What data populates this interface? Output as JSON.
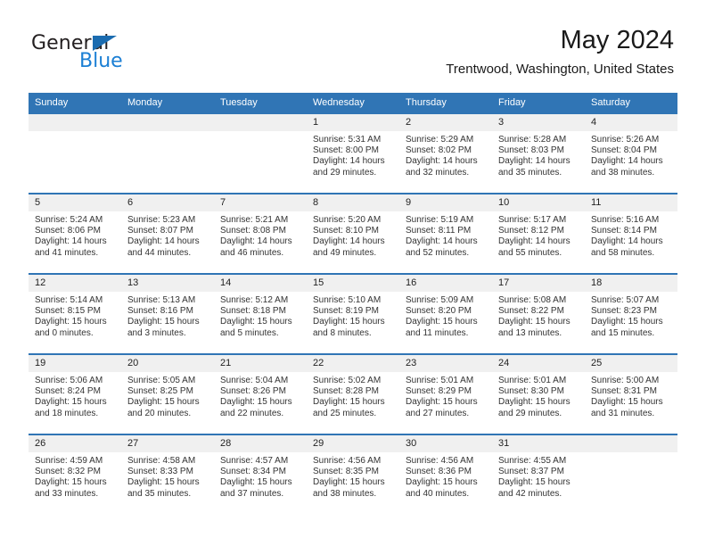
{
  "brand": {
    "name_part1": "General",
    "name_part2": "Blue",
    "accent_color": "#1b7fd4",
    "triangle_color": "#1b6cb0"
  },
  "header": {
    "title": "May 2024",
    "subtitle": "Trentwood, Washington, United States",
    "header_bg_color": "#3075b5",
    "daynum_bg_color": "#f0f0f0"
  },
  "weekday_headers": [
    "Sunday",
    "Monday",
    "Tuesday",
    "Wednesday",
    "Thursday",
    "Friday",
    "Saturday"
  ],
  "weeks": [
    {
      "days": [
        {
          "num": "",
          "sunrise": "",
          "sunset": "",
          "daylight_line1": "",
          "daylight_line2": "",
          "empty": true
        },
        {
          "num": "",
          "sunrise": "",
          "sunset": "",
          "daylight_line1": "",
          "daylight_line2": "",
          "empty": true
        },
        {
          "num": "",
          "sunrise": "",
          "sunset": "",
          "daylight_line1": "",
          "daylight_line2": "",
          "empty": true
        },
        {
          "num": "1",
          "sunrise": "Sunrise: 5:31 AM",
          "sunset": "Sunset: 8:00 PM",
          "daylight_line1": "Daylight: 14 hours",
          "daylight_line2": "and 29 minutes.",
          "empty": false
        },
        {
          "num": "2",
          "sunrise": "Sunrise: 5:29 AM",
          "sunset": "Sunset: 8:02 PM",
          "daylight_line1": "Daylight: 14 hours",
          "daylight_line2": "and 32 minutes.",
          "empty": false
        },
        {
          "num": "3",
          "sunrise": "Sunrise: 5:28 AM",
          "sunset": "Sunset: 8:03 PM",
          "daylight_line1": "Daylight: 14 hours",
          "daylight_line2": "and 35 minutes.",
          "empty": false
        },
        {
          "num": "4",
          "sunrise": "Sunrise: 5:26 AM",
          "sunset": "Sunset: 8:04 PM",
          "daylight_line1": "Daylight: 14 hours",
          "daylight_line2": "and 38 minutes.",
          "empty": false
        }
      ]
    },
    {
      "days": [
        {
          "num": "5",
          "sunrise": "Sunrise: 5:24 AM",
          "sunset": "Sunset: 8:06 PM",
          "daylight_line1": "Daylight: 14 hours",
          "daylight_line2": "and 41 minutes.",
          "empty": false
        },
        {
          "num": "6",
          "sunrise": "Sunrise: 5:23 AM",
          "sunset": "Sunset: 8:07 PM",
          "daylight_line1": "Daylight: 14 hours",
          "daylight_line2": "and 44 minutes.",
          "empty": false
        },
        {
          "num": "7",
          "sunrise": "Sunrise: 5:21 AM",
          "sunset": "Sunset: 8:08 PM",
          "daylight_line1": "Daylight: 14 hours",
          "daylight_line2": "and 46 minutes.",
          "empty": false
        },
        {
          "num": "8",
          "sunrise": "Sunrise: 5:20 AM",
          "sunset": "Sunset: 8:10 PM",
          "daylight_line1": "Daylight: 14 hours",
          "daylight_line2": "and 49 minutes.",
          "empty": false
        },
        {
          "num": "9",
          "sunrise": "Sunrise: 5:19 AM",
          "sunset": "Sunset: 8:11 PM",
          "daylight_line1": "Daylight: 14 hours",
          "daylight_line2": "and 52 minutes.",
          "empty": false
        },
        {
          "num": "10",
          "sunrise": "Sunrise: 5:17 AM",
          "sunset": "Sunset: 8:12 PM",
          "daylight_line1": "Daylight: 14 hours",
          "daylight_line2": "and 55 minutes.",
          "empty": false
        },
        {
          "num": "11",
          "sunrise": "Sunrise: 5:16 AM",
          "sunset": "Sunset: 8:14 PM",
          "daylight_line1": "Daylight: 14 hours",
          "daylight_line2": "and 58 minutes.",
          "empty": false
        }
      ]
    },
    {
      "days": [
        {
          "num": "12",
          "sunrise": "Sunrise: 5:14 AM",
          "sunset": "Sunset: 8:15 PM",
          "daylight_line1": "Daylight: 15 hours",
          "daylight_line2": "and 0 minutes.",
          "empty": false
        },
        {
          "num": "13",
          "sunrise": "Sunrise: 5:13 AM",
          "sunset": "Sunset: 8:16 PM",
          "daylight_line1": "Daylight: 15 hours",
          "daylight_line2": "and 3 minutes.",
          "empty": false
        },
        {
          "num": "14",
          "sunrise": "Sunrise: 5:12 AM",
          "sunset": "Sunset: 8:18 PM",
          "daylight_line1": "Daylight: 15 hours",
          "daylight_line2": "and 5 minutes.",
          "empty": false
        },
        {
          "num": "15",
          "sunrise": "Sunrise: 5:10 AM",
          "sunset": "Sunset: 8:19 PM",
          "daylight_line1": "Daylight: 15 hours",
          "daylight_line2": "and 8 minutes.",
          "empty": false
        },
        {
          "num": "16",
          "sunrise": "Sunrise: 5:09 AM",
          "sunset": "Sunset: 8:20 PM",
          "daylight_line1": "Daylight: 15 hours",
          "daylight_line2": "and 11 minutes.",
          "empty": false
        },
        {
          "num": "17",
          "sunrise": "Sunrise: 5:08 AM",
          "sunset": "Sunset: 8:22 PM",
          "daylight_line1": "Daylight: 15 hours",
          "daylight_line2": "and 13 minutes.",
          "empty": false
        },
        {
          "num": "18",
          "sunrise": "Sunrise: 5:07 AM",
          "sunset": "Sunset: 8:23 PM",
          "daylight_line1": "Daylight: 15 hours",
          "daylight_line2": "and 15 minutes.",
          "empty": false
        }
      ]
    },
    {
      "days": [
        {
          "num": "19",
          "sunrise": "Sunrise: 5:06 AM",
          "sunset": "Sunset: 8:24 PM",
          "daylight_line1": "Daylight: 15 hours",
          "daylight_line2": "and 18 minutes.",
          "empty": false
        },
        {
          "num": "20",
          "sunrise": "Sunrise: 5:05 AM",
          "sunset": "Sunset: 8:25 PM",
          "daylight_line1": "Daylight: 15 hours",
          "daylight_line2": "and 20 minutes.",
          "empty": false
        },
        {
          "num": "21",
          "sunrise": "Sunrise: 5:04 AM",
          "sunset": "Sunset: 8:26 PM",
          "daylight_line1": "Daylight: 15 hours",
          "daylight_line2": "and 22 minutes.",
          "empty": false
        },
        {
          "num": "22",
          "sunrise": "Sunrise: 5:02 AM",
          "sunset": "Sunset: 8:28 PM",
          "daylight_line1": "Daylight: 15 hours",
          "daylight_line2": "and 25 minutes.",
          "empty": false
        },
        {
          "num": "23",
          "sunrise": "Sunrise: 5:01 AM",
          "sunset": "Sunset: 8:29 PM",
          "daylight_line1": "Daylight: 15 hours",
          "daylight_line2": "and 27 minutes.",
          "empty": false
        },
        {
          "num": "24",
          "sunrise": "Sunrise: 5:01 AM",
          "sunset": "Sunset: 8:30 PM",
          "daylight_line1": "Daylight: 15 hours",
          "daylight_line2": "and 29 minutes.",
          "empty": false
        },
        {
          "num": "25",
          "sunrise": "Sunrise: 5:00 AM",
          "sunset": "Sunset: 8:31 PM",
          "daylight_line1": "Daylight: 15 hours",
          "daylight_line2": "and 31 minutes.",
          "empty": false
        }
      ]
    },
    {
      "days": [
        {
          "num": "26",
          "sunrise": "Sunrise: 4:59 AM",
          "sunset": "Sunset: 8:32 PM",
          "daylight_line1": "Daylight: 15 hours",
          "daylight_line2": "and 33 minutes.",
          "empty": false
        },
        {
          "num": "27",
          "sunrise": "Sunrise: 4:58 AM",
          "sunset": "Sunset: 8:33 PM",
          "daylight_line1": "Daylight: 15 hours",
          "daylight_line2": "and 35 minutes.",
          "empty": false
        },
        {
          "num": "28",
          "sunrise": "Sunrise: 4:57 AM",
          "sunset": "Sunset: 8:34 PM",
          "daylight_line1": "Daylight: 15 hours",
          "daylight_line2": "and 37 minutes.",
          "empty": false
        },
        {
          "num": "29",
          "sunrise": "Sunrise: 4:56 AM",
          "sunset": "Sunset: 8:35 PM",
          "daylight_line1": "Daylight: 15 hours",
          "daylight_line2": "and 38 minutes.",
          "empty": false
        },
        {
          "num": "30",
          "sunrise": "Sunrise: 4:56 AM",
          "sunset": "Sunset: 8:36 PM",
          "daylight_line1": "Daylight: 15 hours",
          "daylight_line2": "and 40 minutes.",
          "empty": false
        },
        {
          "num": "31",
          "sunrise": "Sunrise: 4:55 AM",
          "sunset": "Sunset: 8:37 PM",
          "daylight_line1": "Daylight: 15 hours",
          "daylight_line2": "and 42 minutes.",
          "empty": false
        },
        {
          "num": "",
          "sunrise": "",
          "sunset": "",
          "daylight_line1": "",
          "daylight_line2": "",
          "empty": true
        }
      ]
    }
  ]
}
